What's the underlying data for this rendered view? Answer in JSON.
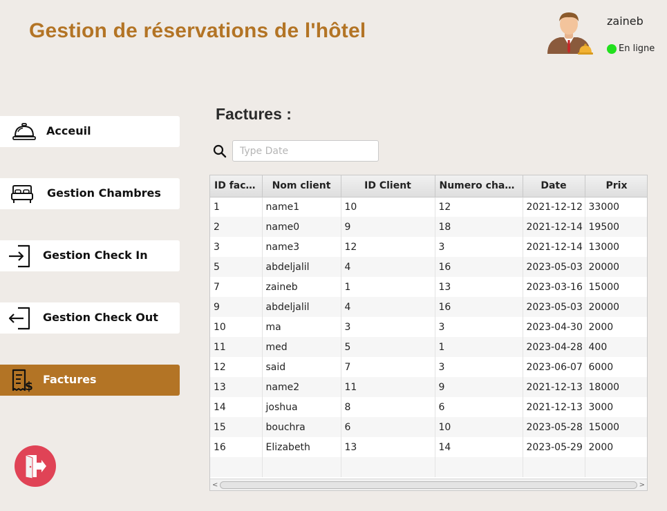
{
  "header": {
    "title": "Gestion de réservations de l'hôtel",
    "user_name": "zaineb",
    "status_text": "En ligne",
    "status_color": "#22e01e"
  },
  "sidebar": {
    "items": [
      {
        "label": "Acceuil",
        "icon": "cloche-icon"
      },
      {
        "label": "Gestion Chambres",
        "icon": "bed-icon"
      },
      {
        "label": "Gestion Check In",
        "icon": "check-in-icon"
      },
      {
        "label": "Gestion Check Out",
        "icon": "check-out-icon"
      },
      {
        "label": "Factures",
        "icon": "invoice-icon",
        "active": true
      }
    ],
    "accent_color": "#b37425",
    "logout_icon": "logout-icon",
    "logout_color": "#e04356"
  },
  "main": {
    "section_title": "Factures :",
    "search": {
      "placeholder": "Type Date",
      "value": ""
    },
    "table": {
      "columns": [
        "ID fact...",
        "Nom client",
        "ID Client",
        "Numero cham...",
        "Date",
        "Prix"
      ],
      "rows": [
        [
          "1",
          "name1",
          "10",
          "12",
          "2021-12-12",
          "33000"
        ],
        [
          "2",
          "name0",
          "9",
          "18",
          "2021-12-14",
          "19500"
        ],
        [
          "3",
          "name3",
          "12",
          "3",
          "2021-12-14",
          "13000"
        ],
        [
          "5",
          "abdeljalil",
          "4",
          "16",
          "2023-05-03",
          "20000"
        ],
        [
          "7",
          "zaineb",
          "1",
          "13",
          "2023-03-16",
          "15000"
        ],
        [
          "9",
          "abdeljalil",
          "4",
          "16",
          "2023-05-03",
          "20000"
        ],
        [
          "10",
          "ma",
          "3",
          "3",
          "2023-04-30",
          "2000"
        ],
        [
          "11",
          "med",
          "5",
          "1",
          "2023-04-28",
          "400"
        ],
        [
          "12",
          "said",
          "7",
          "3",
          "2023-06-07",
          "6000"
        ],
        [
          "13",
          "name2",
          "11",
          "9",
          "2021-12-13",
          "18000"
        ],
        [
          "14",
          "joshua",
          "8",
          "6",
          "2021-12-13",
          "3000"
        ],
        [
          "15",
          "bouchra",
          "6",
          "10",
          "2023-05-28",
          "15000"
        ],
        [
          "16",
          "Elizabeth",
          "13",
          "14",
          "2023-05-29",
          "2000"
        ]
      ]
    }
  }
}
